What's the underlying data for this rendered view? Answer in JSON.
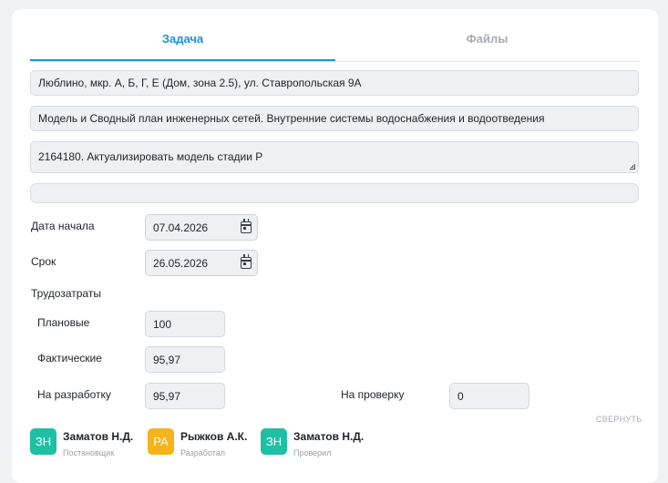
{
  "tabs": {
    "task": "Задача",
    "files": "Файлы"
  },
  "fields": {
    "address": "Люблино, мкр. А, Б, Г, Е (Дом, зона 2.5), ул. Ставропольская 9А",
    "section": "Модель и Сводный план инженерных сетей. Внутренние системы водоснабжения и водоотведения",
    "task_text": "2164180. Актуализировать модель стадии Р",
    "extra": ""
  },
  "dates": {
    "start_label": "Дата начала",
    "start_value": "07.04.2026",
    "deadline_label": "Срок",
    "deadline_value": "26.05.2026"
  },
  "labor": {
    "title": "Трудозатраты",
    "planned_label": "Плановые",
    "planned_value": "100",
    "actual_label": "Фактические",
    "actual_value": "95,97",
    "dev_label": "На разработку",
    "dev_value": "95,97",
    "review_label": "На проверку",
    "review_value": "0"
  },
  "collapse_label": "СВЕРНУТЬ",
  "people": [
    {
      "initials": "ЗН",
      "name": "Заматов Н.Д.",
      "role": "Постановщик",
      "color": "#1fbfa6"
    },
    {
      "initials": "РА",
      "name": "Рыжков А.К.",
      "role": "Разработал",
      "color": "#f6b31b"
    },
    {
      "initials": "ЗН",
      "name": "Заматов Н.Д.",
      "role": "Проверил",
      "color": "#1fbfa6"
    }
  ],
  "icons": {
    "calendar": "calendar-icon"
  }
}
